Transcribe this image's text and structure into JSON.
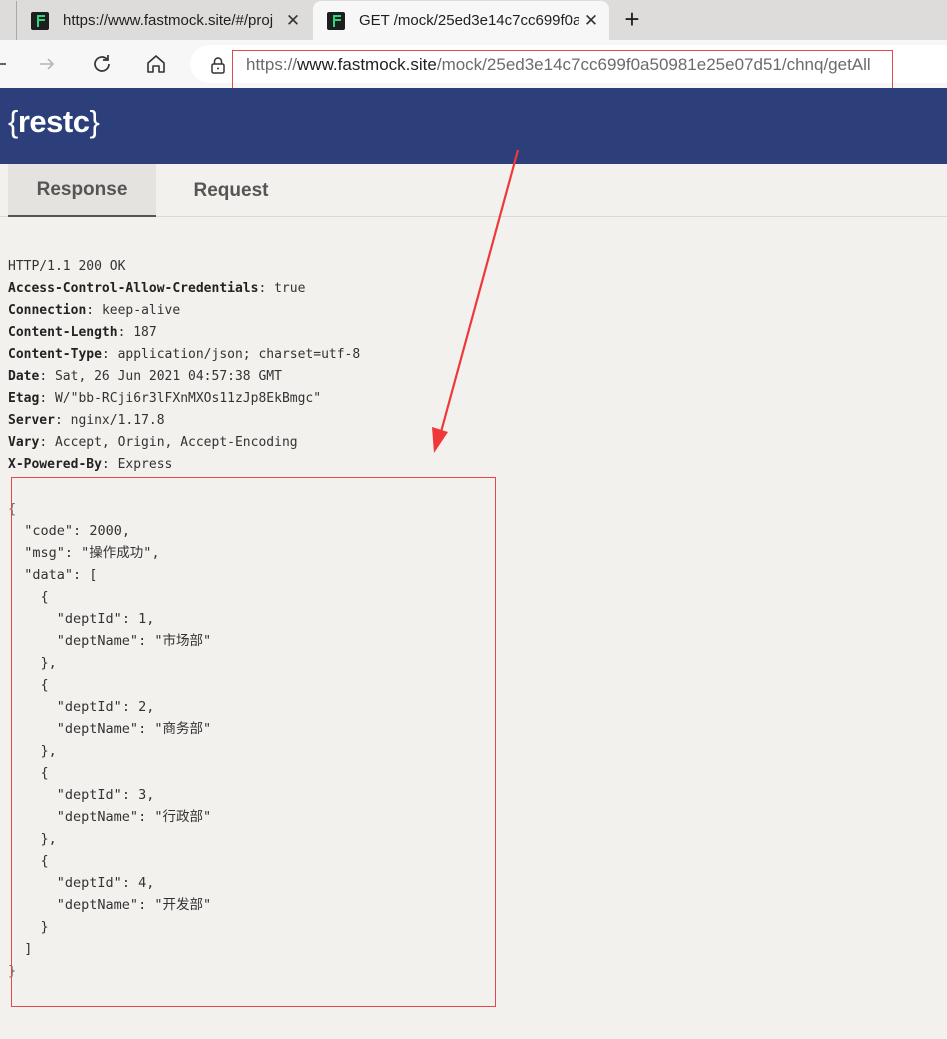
{
  "browser": {
    "tabs": [
      {
        "title": "https://www.fastmock.site/#/proj",
        "active": false
      },
      {
        "title": "GET /mock/25ed3e14c7cc699f0a",
        "active": true
      }
    ],
    "url": {
      "scheme": "https://",
      "host": "www.fastmock.site",
      "path": "/mock/25ed3e14c7cc699f0a50981e25e07d51/chnq/getAll"
    },
    "icons": [
      "favicon-icon",
      "close-icon",
      "plus-icon",
      "back-icon",
      "forward-icon",
      "refresh-icon",
      "home-icon",
      "lock-icon"
    ]
  },
  "app": {
    "brand_open": "{",
    "brand_name": "restc",
    "brand_close": "}",
    "brand_color": "#2c3f7a"
  },
  "tabs": {
    "response": "Response",
    "request": "Request"
  },
  "response": {
    "status_line": "HTTP/1.1 200 OK",
    "headers": [
      {
        "key": "Access-Control-Allow-Credentials",
        "value": "true"
      },
      {
        "key": "Connection",
        "value": "keep-alive"
      },
      {
        "key": "Content-Length",
        "value": "187"
      },
      {
        "key": "Content-Type",
        "value": "application/json; charset=utf-8"
      },
      {
        "key": "Date",
        "value": "Sat, 26 Jun 2021 04:57:38 GMT"
      },
      {
        "key": "Etag",
        "value": "W/\"bb-RCji6r3lFXnMXOs11zJp8EkBmgc\""
      },
      {
        "key": "Server",
        "value": "nginx/1.17.8"
      },
      {
        "key": "Vary",
        "value": "Accept, Origin, Accept-Encoding"
      },
      {
        "key": "X-Powered-By",
        "value": "Express"
      }
    ],
    "body": {
      "code_key": "\"code\"",
      "code_val": "2000",
      "msg_key": "\"msg\"",
      "msg_val": "\"操作成功\"",
      "data_key": "\"data\"",
      "items": [
        {
          "id_key": "\"deptId\"",
          "id_val": "1",
          "name_key": "\"deptName\"",
          "name_val": "\"市场部\""
        },
        {
          "id_key": "\"deptId\"",
          "id_val": "2",
          "name_key": "\"deptName\"",
          "name_val": "\"商务部\""
        },
        {
          "id_key": "\"deptId\"",
          "id_val": "3",
          "name_key": "\"deptName\"",
          "name_val": "\"行政部\""
        },
        {
          "id_key": "\"deptId\"",
          "id_val": "4",
          "name_key": "\"deptName\"",
          "name_val": "\"开发部\""
        }
      ]
    }
  },
  "annotation_color": "#e04a4a"
}
